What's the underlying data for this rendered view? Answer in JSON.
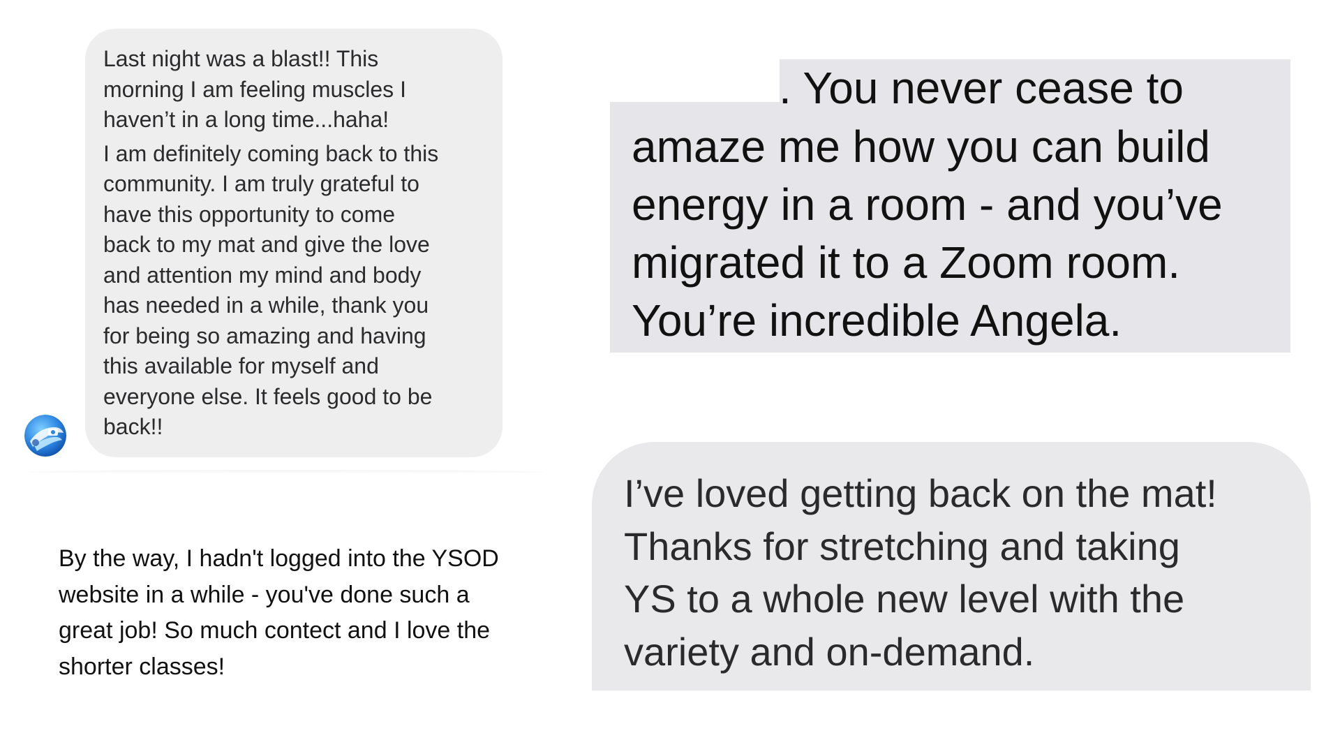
{
  "messages": {
    "top_left": {
      "paragraph_1": "Last night was a blast!! This\nmorning I am feeling muscles I\nhaven’t in a long time...haha!",
      "paragraph_2": "I am definitely coming back to this\ncommunity. I am truly grateful to\nhave this opportunity to come\nback to my mat and give the love\nand attention my mind and body\nhas needed in a while,  thank you\nfor being so amazing and having\nthis available for myself and\neveryone else.  It feels good to be\nback!!",
      "bubble_color": "#eeeeef"
    },
    "bottom_left": {
      "text": "By the way, I hadn't logged into the YSOD\nwebsite in a while - you've done such a\ngreat job! So much contect and I love the\nshorter classes!"
    },
    "top_right": {
      "lines": [
        ". You never cease to",
        "amaze me how you can build",
        "energy in a room - and you’ve",
        "migrated it to a Zoom room.",
        "You’re incredible Angela."
      ],
      "bubble_color": "#e5e5ea"
    },
    "bottom_right": {
      "lines": [
        "I’ve loved getting back on the mat!",
        "Thanks for stretching and taking",
        "YS to a whole new level with the",
        "variety and on-demand."
      ],
      "bubble_color": "#e9e9eb"
    }
  },
  "avatar": {
    "icon": "profile-avatar-icon",
    "colors": [
      "#1e6fd9",
      "#5fb2f0",
      "#ffffff"
    ]
  }
}
